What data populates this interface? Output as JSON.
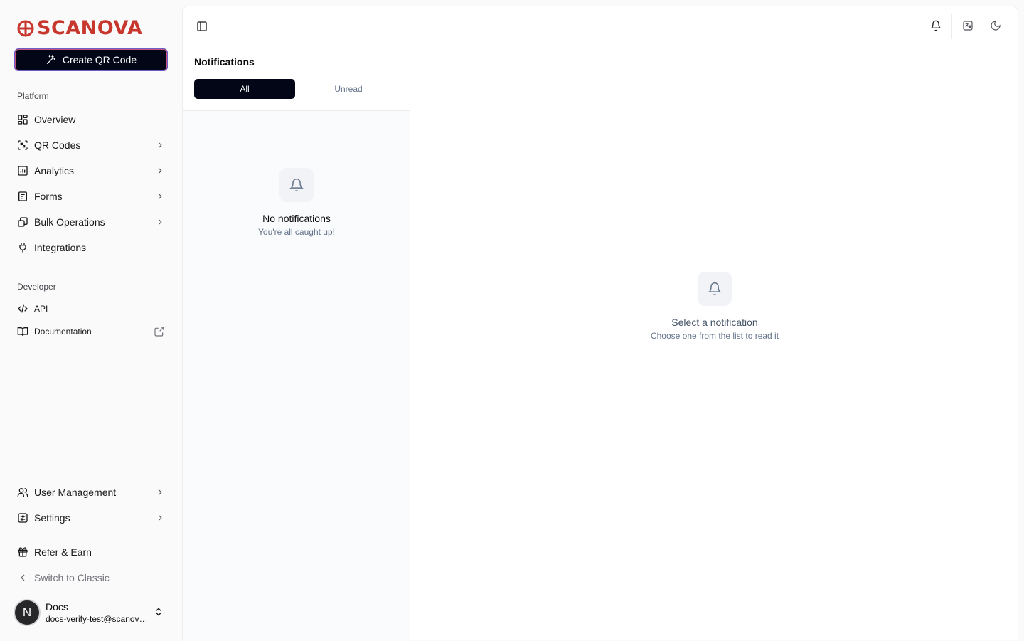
{
  "brand": {
    "name": "SCANOVA",
    "color": "#c8372d"
  },
  "sidebar": {
    "create_button": "Create QR Code",
    "platform_label": "Platform",
    "platform_items": [
      {
        "label": "Overview",
        "icon": "grid-icon"
      },
      {
        "label": "QR Codes",
        "icon": "scan-icon"
      },
      {
        "label": "Analytics",
        "icon": "bar-chart-icon"
      },
      {
        "label": "Forms",
        "icon": "form-icon"
      },
      {
        "label": "Bulk Operations",
        "icon": "layers-icon"
      },
      {
        "label": "Integrations",
        "icon": "plug-icon"
      }
    ],
    "developer_label": "Developer",
    "developer_items": [
      {
        "label": "API",
        "icon": "code-icon"
      },
      {
        "label": "Documentation",
        "icon": "book-icon"
      }
    ],
    "bottom_items": [
      {
        "label": "User Management",
        "icon": "users-icon"
      },
      {
        "label": "Settings",
        "icon": "settings-icon"
      },
      {
        "label": "Refer & Earn",
        "icon": "gift-icon"
      },
      {
        "label": "Switch to Classic",
        "icon": "chevron-left-icon"
      }
    ],
    "user": {
      "initial": "N",
      "name": "Docs",
      "email": "docs-verify-test@scanova.io"
    }
  },
  "notifications": {
    "title": "Notifications",
    "tabs": [
      "All",
      "Unread"
    ],
    "active_tab": "All",
    "empty_title": "No notifications",
    "empty_subtitle": "You're all caught up!"
  },
  "detail": {
    "empty_title": "Select a notification",
    "empty_subtitle": "Choose one from the list to read it"
  }
}
